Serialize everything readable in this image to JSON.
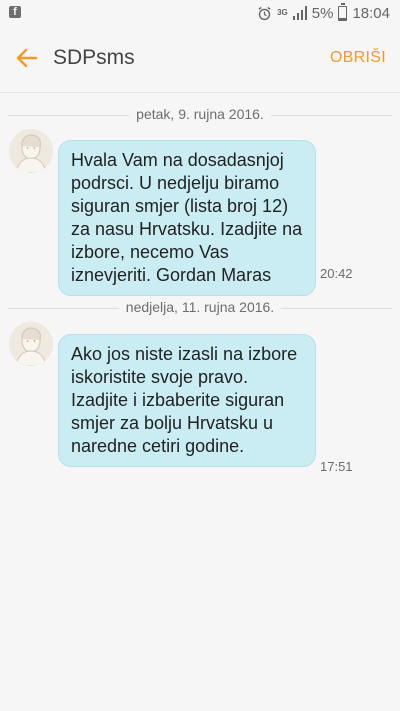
{
  "status_bar": {
    "left_icon": "facebook-icon",
    "icons": [
      "alarm-icon",
      "3g-icon",
      "signal-icon"
    ],
    "network": "3G",
    "battery": "5%",
    "time": "18:04"
  },
  "app_bar": {
    "title": "SDPsms",
    "delete_label": "OBRIŠI",
    "accent_color": "#f39a22"
  },
  "messages": [
    {
      "date": "petak, 9. rujna 2016.",
      "text": "Hvala Vam na dosadasnjoj podrsci. U nedjelju biramo siguran smjer (lista broj 12) za nasu Hrvatsku. Izadjite na izbore, necemo Vas iznevjeriti. Gordan Maras",
      "time": "20:42"
    },
    {
      "date": "nedjelja, 11. rujna 2016.",
      "text": "Ako jos niste izasli na izbore iskoristite svoje pravo. Izadjite i izbaberite siguran smjer za bolju Hrvatsku u naredne cetiri godine.",
      "time": "17:51"
    }
  ]
}
